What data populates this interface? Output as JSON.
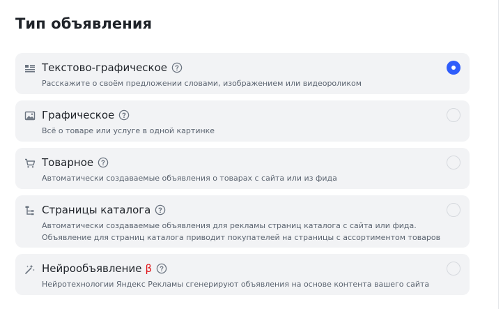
{
  "section": {
    "title": "Тип объявления"
  },
  "options": [
    {
      "icon": "text-graphic-icon",
      "title": "Текстово-графическое",
      "beta": "",
      "description": "Расскажите о своём предложении словами, изображением или видеороликом",
      "description_line2": "",
      "selected": true
    },
    {
      "icon": "image-icon",
      "title": "Графическое",
      "beta": "",
      "description": "Всё о товаре или услуге в одной картинке",
      "description_line2": "",
      "selected": false
    },
    {
      "icon": "cart-icon",
      "title": "Товарное",
      "beta": "",
      "description": "Автоматически создаваемые объявления о товарах с сайта или из фида",
      "description_line2": "",
      "selected": false
    },
    {
      "icon": "catalog-tree-icon",
      "title": "Страницы каталога",
      "beta": "",
      "description": "Автоматически создаваемые объявления для рекламы страниц каталога с сайта или фида.",
      "description_line2": "Объявление для страниц каталога приводит покупателей на страницы с ассортиментом товаров",
      "selected": false
    },
    {
      "icon": "magic-wand-icon",
      "title": "Нейрообъявление",
      "beta": "β",
      "description": "Нейротехнологии Яндекс Рекламы сгенерируют объявления на основе контента вашего сайта",
      "description_line2": "",
      "selected": false
    }
  ],
  "colors": {
    "accent": "#2f5dfb",
    "card_background": "#f2f3f5",
    "beta": "#e0161a"
  }
}
